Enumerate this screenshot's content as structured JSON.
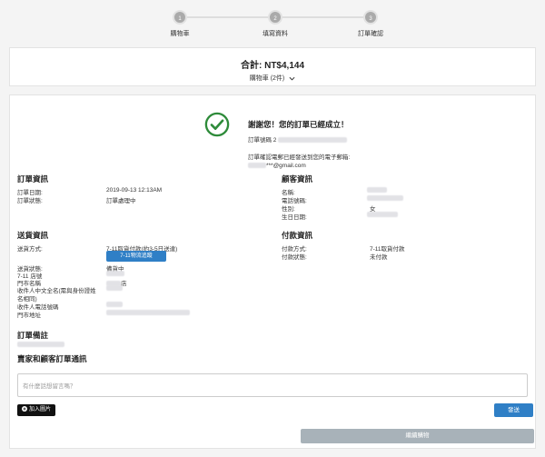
{
  "stepper": {
    "steps": [
      {
        "num": "1",
        "label": "購物車"
      },
      {
        "num": "2",
        "label": "填寫資料"
      },
      {
        "num": "3",
        "label": "訂單確認"
      }
    ]
  },
  "summary": {
    "total_label": "合計: NT$4,144",
    "cart_label": "購物車 (2件)"
  },
  "success": {
    "thanks": "謝謝您！您的訂單已經成立！",
    "order_no_label": "訂單號碼 2",
    "notice": "訂單確認電郵已經發送到您的電子郵箱:",
    "email_suffix": "***@gmail.com"
  },
  "order_info": {
    "title": "訂單資訊",
    "date_label": "訂單日期:",
    "date_value": "2019-09-13 12:13AM",
    "status_label": "訂單狀態:",
    "status_value": "訂單處理中"
  },
  "customer_info": {
    "title": "顧客資訊",
    "name_label": "名稱:",
    "phone_label": "電話號碼:",
    "gender_label": "性別:",
    "gender_value": "女",
    "birthday_label": "生日日期:"
  },
  "delivery_info": {
    "title": "送貨資訊",
    "method_label": "送貨方式:",
    "method_value": "7-11取貨付款(約3-5日送達)",
    "track_button": "7-11物流追蹤",
    "status_label": "送貨狀態:",
    "status_value": "備貨中",
    "store_no_label": "7-11 店號",
    "store_name_label": "門市名稱",
    "store_name_partial": "店",
    "recipient_label_1": "收件人中文全名(需與身份證姓",
    "recipient_label_2": "名相同)",
    "recipient_phone_label": "收件人電話號碼",
    "store_address_label": "門市地址"
  },
  "payment_info": {
    "title": "付款資訊",
    "method_label": "付款方式:",
    "method_value": "7-11取貨付款",
    "status_label": "付款狀態:",
    "status_value": "未付款"
  },
  "order_note": {
    "title": "訂單備註"
  },
  "messages": {
    "title": "賣家和顧客訂單通訊",
    "placeholder": "有什麼話想留言嗎？",
    "add_image_button": "加入圖片",
    "send_button": "發送"
  },
  "continue_button": "繼續購物",
  "colors": {
    "accent": "#2f7fc6",
    "success_green": "#2e8b3a",
    "continue_disabled": "#a8b2b9"
  }
}
